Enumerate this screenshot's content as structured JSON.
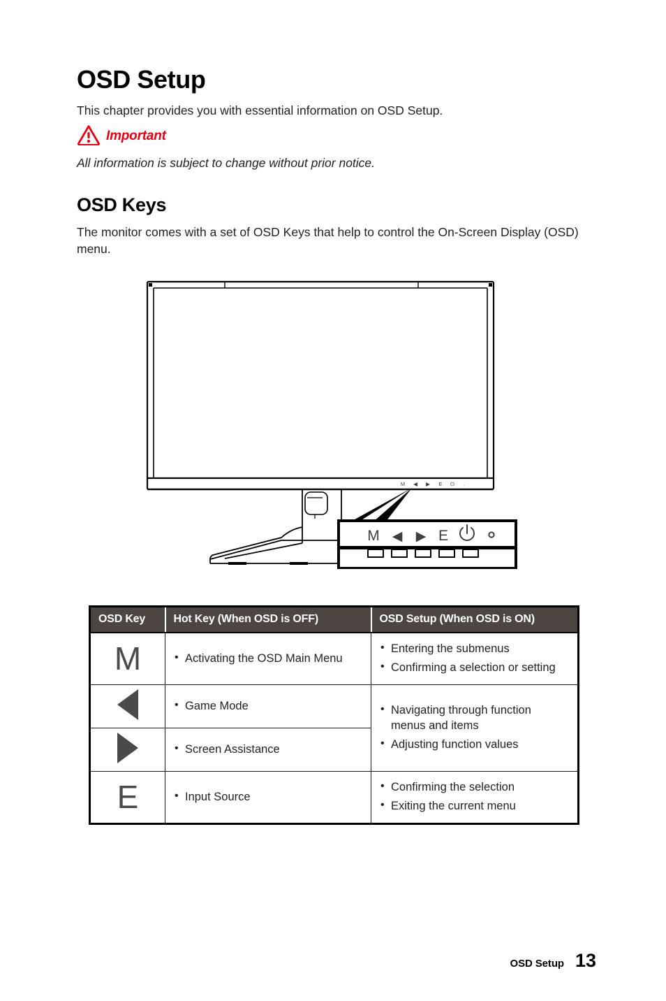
{
  "document": {
    "chapter_title": "OSD Setup",
    "intro": "This chapter provides you with essential information on OSD Setup.",
    "important_label": "Important",
    "important_note": "All information is subject to change without prior notice.",
    "section_title": "OSD Keys",
    "section_body": "The monitor comes with a set of OSD Keys that help to control the On-Screen Display (OSD) menu."
  },
  "figure": {
    "caption_keys": [
      "M",
      "◀",
      "▶",
      "E",
      "⏻",
      "○"
    ],
    "callout_keys": [
      "M",
      "◀",
      "▶",
      "E"
    ],
    "power_icon": "power-icon",
    "led_icon": "led-indicator-icon",
    "button_count": 5
  },
  "table": {
    "headers": [
      "OSD Key",
      "Hot Key (When OSD is OFF)",
      "OSD Setup (When OSD is ON)"
    ],
    "header_bg": "#4c4542",
    "rows": [
      {
        "key_glyph": "M",
        "key_type": "letter",
        "hotkey": [
          "Activating the OSD Main Menu"
        ],
        "osd_setup": [
          "Entering the submenus",
          "Confirming a selection or setting"
        ]
      },
      {
        "key_glyph": "◀",
        "key_type": "arrow-left",
        "hotkey": [
          "Game Mode"
        ],
        "osd_setup": [
          "Navigating through function menus and items",
          "Adjusting function values"
        ]
      },
      {
        "key_glyph": "▶",
        "key_type": "arrow-right",
        "hotkey": [
          "Screen Assistance"
        ],
        "osd_setup": []
      },
      {
        "key_glyph": "E",
        "key_type": "letter",
        "hotkey": [
          "Input Source"
        ],
        "osd_setup": [
          "Confirming the selection",
          "Exiting the current menu"
        ]
      }
    ]
  },
  "footer": {
    "section_name": "OSD Setup",
    "page_number": "13"
  },
  "colors": {
    "accent_red": "#e60012",
    "table_header": "#4c4542",
    "key_glyph": "#4a4a4a",
    "text": "#231f20"
  }
}
